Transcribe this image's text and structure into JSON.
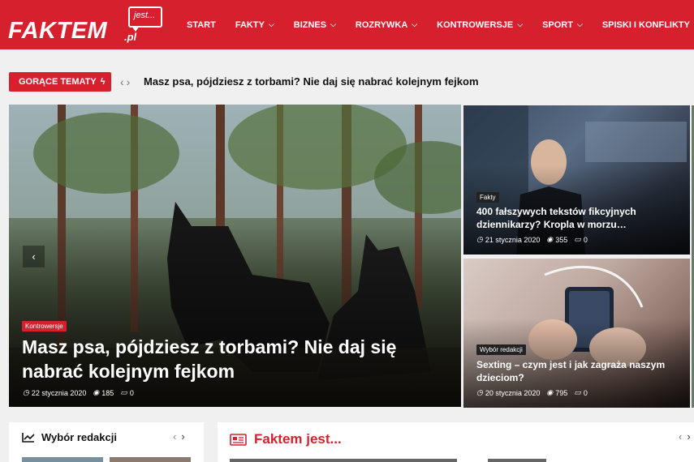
{
  "header": {
    "logo_text": "FAKTEM",
    "logo_suffix": ".pl",
    "logo_bubble": "jest...",
    "nav": [
      {
        "label": "START",
        "dropdown": false
      },
      {
        "label": "FAKTY",
        "dropdown": true
      },
      {
        "label": "BIZNES",
        "dropdown": true
      },
      {
        "label": "ROZRYWKA",
        "dropdown": true
      },
      {
        "label": "KONTROWERSJE",
        "dropdown": true
      },
      {
        "label": "SPORT",
        "dropdown": true
      },
      {
        "label": "SPISKI I KONFLIKTY",
        "dropdown": true
      }
    ]
  },
  "hot_topics": {
    "label": "GORĄCE TEMATY",
    "headline": "Masz psa, pójdziesz z torbami? Nie daj się nabrać kolejnym fejkom"
  },
  "main_feature": {
    "category": "Kontrowersje",
    "title": "Masz psa, pójdziesz z torbami? Nie daj się nabrać kolejnym fejkom",
    "date": "22 stycznia 2020",
    "views": "185",
    "comments": "0"
  },
  "side_features": [
    {
      "category": "Fakty",
      "title": "400 fałszywych tekstów fikcyjnych dziennikarzy? Kropla w morzu…",
      "date": "21 stycznia 2020",
      "views": "355",
      "comments": "0"
    },
    {
      "category": "Wybór redakcji",
      "title": "Sexting – czym jest i jak zagraża naszym dzieciom?",
      "date": "20 stycznia 2020",
      "views": "795",
      "comments": "0"
    }
  ],
  "panels": {
    "editors_pick": "Wybór redakcji",
    "faktem_jest": "Faktem jest..."
  },
  "colors": {
    "brand_red": "#d6202d",
    "text_dark": "#111111"
  },
  "icons": {
    "date": "clock-icon",
    "views": "eye-icon",
    "comments": "comment-icon",
    "hot": "bolt-icon",
    "chart": "chart-line-icon",
    "news": "newspaper-icon"
  }
}
